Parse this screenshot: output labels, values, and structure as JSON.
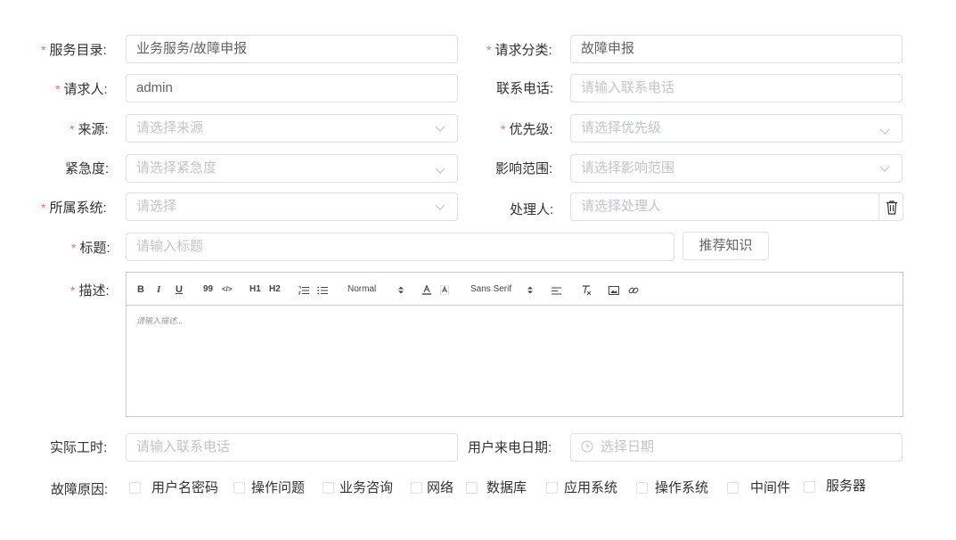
{
  "form": {
    "service_catalog": {
      "label": "服务目录:",
      "value": "业务服务/故障申报"
    },
    "request_category": {
      "label": "请求分类:",
      "value": "故障申报"
    },
    "requester": {
      "label": "请求人:",
      "value": "admin"
    },
    "contact_phone": {
      "label": "联系电话:",
      "placeholder": "请输入联系电话"
    },
    "source": {
      "label": "来源:",
      "placeholder": "请选择来源"
    },
    "priority": {
      "label": "优先级:",
      "placeholder": "请选择优先级"
    },
    "urgency": {
      "label": "紧急度:",
      "placeholder": "请选择紧急度"
    },
    "impact": {
      "label": "影响范围:",
      "placeholder": "请选择影响范围"
    },
    "system": {
      "label": "所属系统:",
      "placeholder": "请选择"
    },
    "handler": {
      "label": "处理人:",
      "placeholder": "请选择处理人"
    },
    "title": {
      "label": "标题:",
      "placeholder": "请输入标题"
    },
    "recommend_button": "推荐知识",
    "description": {
      "label": "描述:",
      "placeholder": "请输入描述..."
    },
    "actual_hours": {
      "label": "实际工时:",
      "placeholder": "请输入联系电话"
    },
    "call_date": {
      "label": "用户来电日期:",
      "placeholder": "选择日期"
    },
    "fault_cause": {
      "label": "故障原因:",
      "options": [
        "用户名密码",
        "操作问题",
        "业务咨询",
        "网络",
        "数据库",
        "应用系统",
        "操作系统",
        "中间件",
        "服务器"
      ]
    }
  },
  "toolbar": {
    "bold": "B",
    "italic": "I",
    "underline": "U",
    "quote": "99",
    "code": "</>",
    "h1": "H1",
    "h2": "H2",
    "header": "Normal",
    "font": "Sans Serif"
  },
  "required_mark": "*"
}
